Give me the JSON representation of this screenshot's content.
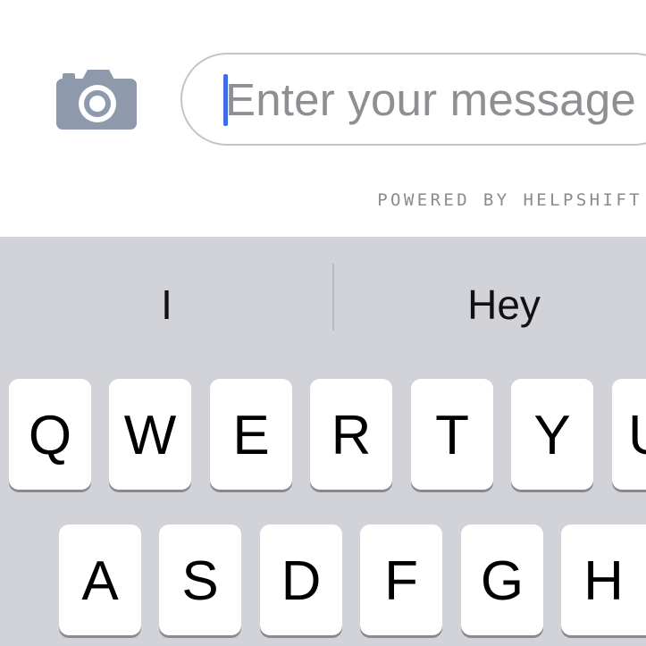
{
  "compose": {
    "camera_icon": "camera-icon",
    "camera_color": "#8e99ab",
    "message_placeholder": "Enter your message",
    "caret_color": "#3e6ee6",
    "powered_by": "POWERED BY HELPSHIFT"
  },
  "keyboard": {
    "suggestions": [
      "I",
      "Hey"
    ],
    "row1": [
      "Q",
      "W",
      "E",
      "R",
      "T",
      "Y",
      "U"
    ],
    "row2": [
      "A",
      "S",
      "D",
      "F",
      "G",
      "H"
    ],
    "background": "#d1d3d9",
    "key_color": "#ffffff"
  }
}
